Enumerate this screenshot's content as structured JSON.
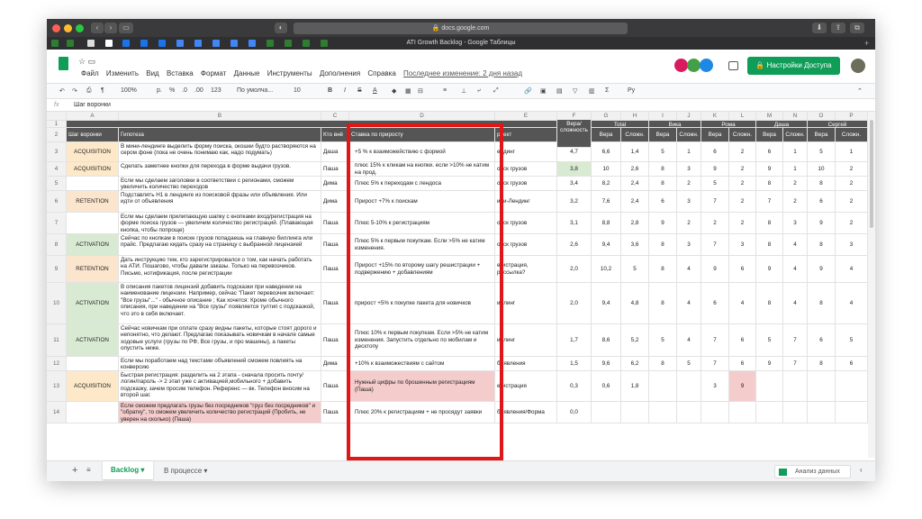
{
  "browser": {
    "url": "docs.google.com",
    "page_title": "ATI Growth Backlog - Google Таблицы"
  },
  "menu": [
    "Файл",
    "Изменить",
    "Вид",
    "Вставка",
    "Формат",
    "Данные",
    "Инструменты",
    "Дополнения",
    "Справка"
  ],
  "last_edit": "Последнее изменение: 2 дня назад",
  "share_label": "Настройки Доступа",
  "toolbar": {
    "zoom": "100%",
    "currency": "р.",
    "percent": "%",
    "dec0": ".0",
    "dec00": ".00",
    "fmt": "123",
    "font": "По умолча...",
    "size": "10",
    "bold": "B",
    "italic": "I",
    "strike": "S",
    "color": "A"
  },
  "fx": {
    "label": "fx",
    "value": "Шаг воронки"
  },
  "columns": [
    "A",
    "B",
    "C",
    "D",
    "E",
    "F",
    "G",
    "H",
    "I",
    "J",
    "K",
    "L",
    "M",
    "N",
    "O",
    "P"
  ],
  "group_headers": {
    "g": "Total",
    "i": "Вика",
    "k": "Рома",
    "m": "Даша",
    "o": "Сергей"
  },
  "header_row": {
    "a": "Шаг воронки",
    "b": "Гипотеза",
    "c": "Кто внё",
    "d": "Ставка по приросту",
    "e": "роект",
    "f": "Вера/сложность",
    "sub": [
      "Вера",
      "Сложн.",
      "Вера",
      "Сложн.",
      "Вера",
      "Сложн.",
      "Вера",
      "Сложн.",
      "Вера",
      "Сложн."
    ]
  },
  "rows": [
    {
      "n": "3",
      "stage": "ACQUISITION",
      "hyp": "В мини-лендинге выделить форму поиска, окошки будто растворяются на сером фоне (пока не очень понимаю как, надо подумать)",
      "who": "Даша",
      "bet": "+5 % к взаиможействию с формой",
      "proj": "ендинг",
      "f": "4,7",
      "v": [
        "6,6",
        "1,4",
        "5",
        "1",
        "6",
        "2",
        "6",
        "1",
        "5",
        "1"
      ]
    },
    {
      "n": "4",
      "stage": "ACQUISITION",
      "hyp": "Сделать заметнее кнопки для перехода в форме выдачи грузов.",
      "who": "Паша",
      "bet": "плюс 15% к кликам на кнопки. если >10% не катим на прод.",
      "proj": "оиск грузов",
      "f": "3,8",
      "v": [
        "10",
        "2,6",
        "8",
        "3",
        "9",
        "2",
        "9",
        "1",
        "10",
        "2"
      ]
    },
    {
      "n": "5",
      "stage": "",
      "hyp": "Если мы сделаем заголовки в соответствии с регионами, сможем увеличить количество переходов",
      "who": "Дима",
      "bet": "Плюс 5% к переходам с лендоса",
      "proj": "оиск грузов",
      "f": "3,4",
      "v": [
        "8,2",
        "2,4",
        "8",
        "2",
        "5",
        "2",
        "8",
        "2",
        "8",
        "2"
      ]
    },
    {
      "n": "6",
      "stage": "RETENTION",
      "hyp": "Подставлять H1 в лендинге из поисковой фразы или объявления. Или идти от объявления",
      "who": "Дима",
      "bet": "Прирост +7% к поискам",
      "proj": "ини-Лендинг",
      "f": "3,2",
      "v": [
        "7,6",
        "2,4",
        "6",
        "3",
        "7",
        "2",
        "7",
        "2",
        "6",
        "2"
      ]
    },
    {
      "n": "7",
      "stage": "",
      "hyp": "Если мы сделаем прилипающую шапку с кнопками вход/регистрация на форме поиска грузов — увеличим количество регистраций. (Плавающая кнопка, чтобы попроще)",
      "who": "Паша",
      "bet": "Плюс 5-10% к регистрациям",
      "proj": "оиск грузов",
      "f": "3,1",
      "v": [
        "8,8",
        "2,8",
        "9",
        "2",
        "2",
        "2",
        "8",
        "3",
        "9",
        "2"
      ]
    },
    {
      "n": "8",
      "stage": "ACTIVATION",
      "hyp": "Сейчас по кнопкам в поиске грузов попадаешь на главную биллинга или прайс. Предлагаю кидать сразу на страницу с выбранной лицензией",
      "who": "Паша",
      "bet": "Плюс 5% к первым покупкам. Если >5% не катим изменения.",
      "proj": "оиск грузов",
      "f": "2,6",
      "v": [
        "9,4",
        "3,6",
        "8",
        "3",
        "7",
        "3",
        "8",
        "4",
        "8",
        "3"
      ]
    },
    {
      "n": "9",
      "stage": "RETENTION",
      "hyp": "Дать инструкцию тем, кто зарегистрировался о том, как начать работать на АТИ. Пошагово, чтобы давали заказы. Только на перевозчиков. Письмо, нотификация, после регистрации",
      "who": "Паша",
      "bet": "Прирост +15% по второму шагу решистрации + подвержению + добавлениям",
      "proj": "егистрация, рассылка?",
      "f": "2,0",
      "v": [
        "10,2",
        "5",
        "8",
        "4",
        "9",
        "6",
        "9",
        "4",
        "9",
        "4"
      ]
    },
    {
      "n": "10",
      "stage": "ACTIVATION",
      "hyp": "В описания пакетов лицензий добавить подсказки при наведении на наименование лицензии. Например, сейчас \"Пакет перевозчик включает: \"Все грузы\"...\" - обычное описание ; Как хочется: Кроме обычного описания, при наведении на \"Все грузы\" появляется тултип с подсказкой, что это в себя включает.",
      "who": "Паша",
      "bet": "прирост +5% к покупке пакета для новичков",
      "proj": "иллинг",
      "f": "2,0",
      "v": [
        "9,4",
        "4,8",
        "8",
        "4",
        "6",
        "4",
        "8",
        "4",
        "8",
        "4"
      ]
    },
    {
      "n": "11",
      "stage": "ACTIVATION",
      "hyp": "Сейчас новичкам при оплате сразу видны пакеты, которые стоят дорого и непонятно, что делают. Предлагаю показывать новичкам в начале самые ходовые услуги (грузы по РФ, Все грузы, и про машины), а пакеты опустить ниже.",
      "who": "Паша",
      "bet": "Плюс 10% к первым покупкам. Если >5% не катим изменения. Запустить отдельно по мобилам и десктопу",
      "proj": "иллинг",
      "f": "1,7",
      "v": [
        "8,6",
        "5,2",
        "5",
        "4",
        "7",
        "6",
        "5",
        "7",
        "6",
        "5"
      ]
    },
    {
      "n": "12",
      "stage": "",
      "hyp": "Если мы поработаем над текстами объявлений сможем повлиять на конверсию",
      "who": "Дима",
      "bet": "+10% к взаиможествиям с сайтом",
      "proj": "бъявления",
      "f": "1,5",
      "v": [
        "9,6",
        "6,2",
        "8",
        "5",
        "7",
        "6",
        "9",
        "7",
        "8",
        "6"
      ]
    },
    {
      "n": "13",
      "stage": "ACQUISITION",
      "hyp": "Быстрая регистрация: разделить на 2 этапа - сначала просить почту/логин/пароль -> 2 этап уже с активацией,мобильного + добавить подсказку, зачем просим телефон. Референс — вк. Телефон вносим на второй шаг.",
      "who": "Паша",
      "bet": "Нужный цифры по брошенным регистрациям (Паша)",
      "proj": "егистрация",
      "f": "0,3",
      "v": [
        "0,6",
        "1,8",
        "",
        "",
        "3",
        "9",
        "",
        "",
        "",
        ""
      ]
    },
    {
      "n": "14",
      "stage": "",
      "hyp": "Если сможем предлагать грузы без посредников \"груз без посредников\" и \"обратку\", то сможем увеличить количество регистраций (Пробить, не уверен на сколько) (Паша)",
      "who": "Паша",
      "bet": "Плюс 20% к регистрациям + не просядут заявки",
      "proj": "бъявления/Форма",
      "f": "0,0",
      "v": [
        "",
        "",
        "",
        "",
        "",
        "",
        "",
        "",
        "",
        ""
      ]
    }
  ],
  "tabs": {
    "active": "Backlog",
    "other": "В процессе"
  },
  "explore_label": "Анализ данных",
  "colors": {
    "acq": "#fde9c9",
    "act": "#d9ead3",
    "ret": "#fce5cd",
    "pink": "#f4cccc",
    "green_share": "#0f9d58",
    "red_box": "#e01717"
  }
}
